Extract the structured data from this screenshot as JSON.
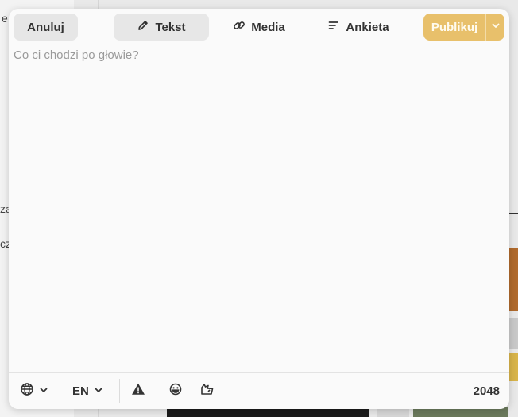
{
  "background": {
    "fragments": [
      "e",
      "za",
      "cz"
    ]
  },
  "toolbar": {
    "cancel_label": "Anuluj",
    "tabs": [
      {
        "label": "Tekst",
        "icon": "pencil-icon",
        "selected": true
      },
      {
        "label": "Media",
        "icon": "link-icon",
        "selected": false
      },
      {
        "label": "Ankieta",
        "icon": "poll-icon",
        "selected": false
      }
    ],
    "publish_label": "Publikuj",
    "accent_color": "#e8c06b"
  },
  "editor": {
    "value": "",
    "placeholder": "Co ci chodzi po głowie?"
  },
  "footer": {
    "visibility_icon": "globe-icon",
    "language": "EN",
    "warning_icon": "warning-icon",
    "emoji_icon": "emoji-icon",
    "gif_icon": "gif-icon",
    "char_count": "2048"
  }
}
